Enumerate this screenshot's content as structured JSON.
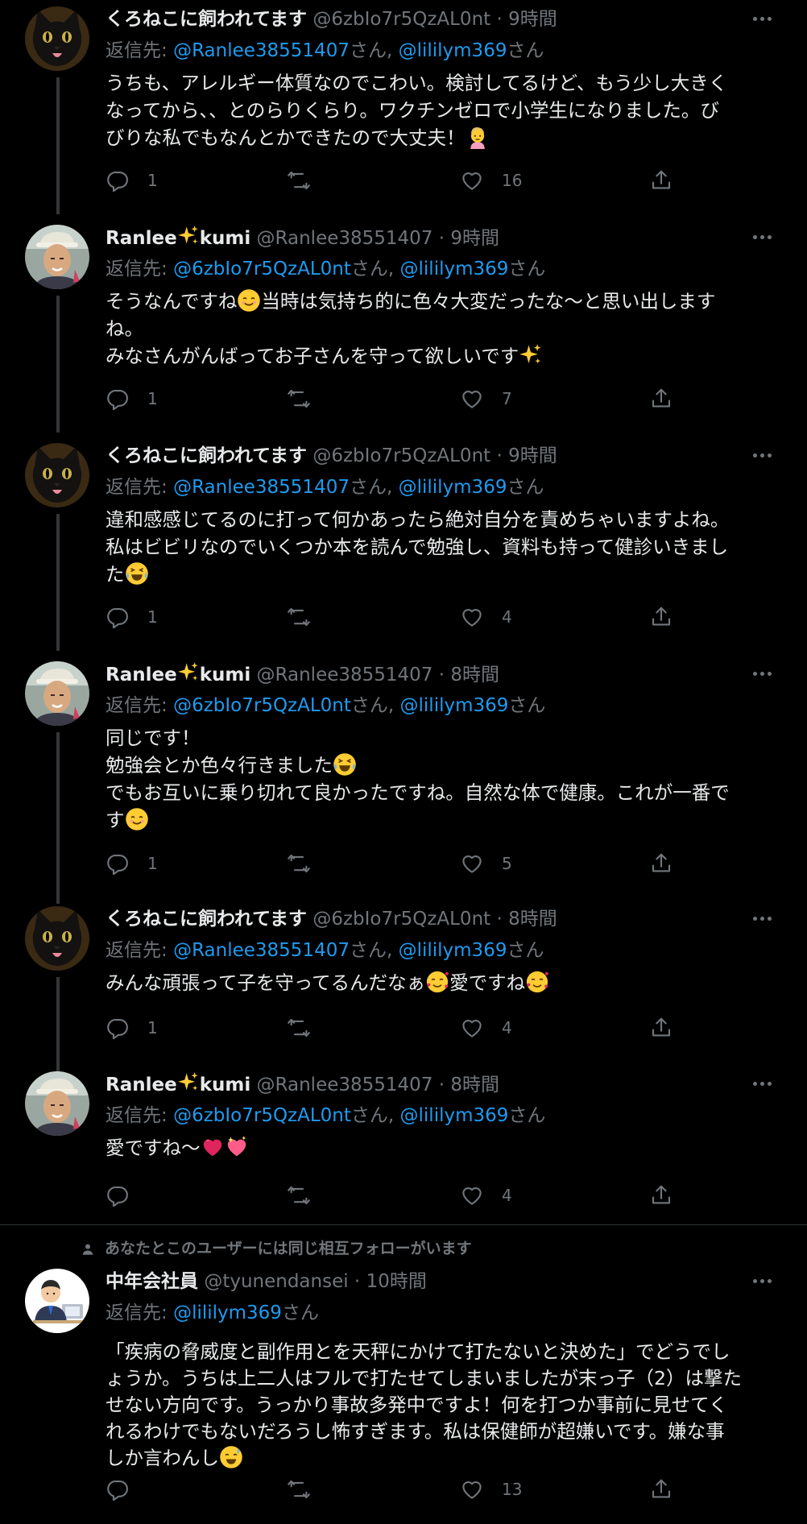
{
  "colors": {
    "background": "#000000",
    "text": "#e7e9ea",
    "secondary": "#71767b",
    "accent": "#1d9bf0",
    "divider": "#2f3336"
  },
  "icons": {
    "reply": "reply-icon",
    "retweet": "retweet-icon",
    "like": "heart-icon",
    "share": "share-icon",
    "more": "more-icon"
  },
  "social_context": "あなたとこのユーザーには同じ相互フォローがいます",
  "tweets": [
    {
      "name": "くろねこに飼われてます",
      "handle": "@6zbIo7r5QzAL0nt",
      "sep": " · ",
      "time": "9時間",
      "reply_prefix": "返信先: ",
      "m1": "@Ranlee38551407",
      "s1": "さん, ",
      "m2": "@lililym369",
      "s2": "さん",
      "text": "うちも、アレルギー体質なのでこわい。検討してるけど、もう少し大きく\nなってから、、とのらりくらり。ワクチンゼロで小学生になりました。び\nびりな私でもなんとかできたので大丈夫！",
      "replies": "1",
      "retweets": "",
      "likes": "16"
    },
    {
      "name_a": "Ranlee",
      "name_b": "kumi",
      "handle": "@Ranlee38551407",
      "sep": " · ",
      "time": "9時間",
      "reply_prefix": "返信先: ",
      "m1": "@6zbIo7r5QzAL0nt",
      "s1": "さん, ",
      "m2": "@lililym369",
      "s2": "さん",
      "text_a": "そうなんですね",
      "text_b": "当時は気持ち的に色々大変だったな～と思い出します\nね。\nみなさんがんばってお子さんを守って欲しいです",
      "replies": "1",
      "retweets": "",
      "likes": "7"
    },
    {
      "name": "くろねこに飼われてます",
      "handle": "@6zbIo7r5QzAL0nt",
      "sep": " · ",
      "time": "9時間",
      "reply_prefix": "返信先: ",
      "m1": "@Ranlee38551407",
      "s1": "さん, ",
      "m2": "@lililym369",
      "s2": "さん",
      "text": "違和感感じてるのに打って何かあったら絶対自分を責めちゃいますよね。\n私はビビリなのでいくつか本を読んで勉強し、資料も持って健診いきまし\nた",
      "replies": "1",
      "retweets": "",
      "likes": "4"
    },
    {
      "name_a": "Ranlee",
      "name_b": "kumi",
      "handle": "@Ranlee38551407",
      "sep": " · ",
      "time": "8時間",
      "reply_prefix": "返信先: ",
      "m1": "@6zbIo7r5QzAL0nt",
      "s1": "さん, ",
      "m2": "@lililym369",
      "s2": "さん",
      "text_a": "同じです！\n勉強会とか色々行きました",
      "text_b": "\nでもお互いに乗り切れて良かったですね。自然な体で健康。これが一番で\nす",
      "replies": "1",
      "retweets": "",
      "likes": "5"
    },
    {
      "name": "くろねこに飼われてます",
      "handle": "@6zbIo7r5QzAL0nt",
      "sep": " · ",
      "time": "8時間",
      "reply_prefix": "返信先: ",
      "m1": "@Ranlee38551407",
      "s1": "さん, ",
      "m2": "@lililym369",
      "s2": "さん",
      "text_a": "みんな頑張って子を守ってるんだなぁ",
      "text_b": "愛ですね",
      "replies": "1",
      "retweets": "",
      "likes": "4"
    },
    {
      "name_a": "Ranlee",
      "name_b": "kumi",
      "handle": "@Ranlee38551407",
      "sep": " · ",
      "time": "8時間",
      "reply_prefix": "返信先: ",
      "m1": "@6zbIo7r5QzAL0nt",
      "s1": "さん, ",
      "m2": "@lililym369",
      "s2": "さん",
      "text": "愛ですね～",
      "replies": "",
      "retweets": "",
      "likes": "4"
    },
    {
      "name": "中年会社員",
      "handle": "@tyunendansei",
      "sep": " · ",
      "time": "10時間",
      "reply_prefix": "返信先: ",
      "m1": "@lililym369",
      "s1": "さん",
      "text": "「疾病の脅威度と副作用とを天秤にかけて打たないと決めた」でどうでし\nょうか。うちは上二人はフルで打たせてしまいましたが末っ子（2）は撃た\nせない方向です。うっかり事故多発中ですよ！何を打つか事前に見せてく\nれるわけでもないだろうし怖すぎます。私は保健師が超嫌いです。嫌な事\nしか言わんし",
      "replies": "",
      "retweets": "",
      "likes": "13"
    }
  ]
}
